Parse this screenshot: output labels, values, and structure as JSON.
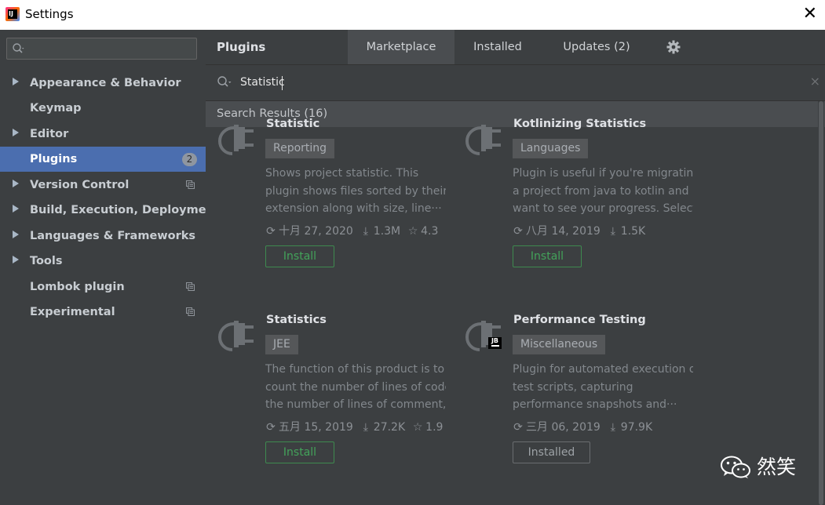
{
  "window": {
    "title": "Settings",
    "close_glyph": "✕"
  },
  "sidebar": {
    "search": {
      "value": "",
      "placeholder": ""
    },
    "items": [
      {
        "label": "Appearance & Behavior",
        "expandable": true
      },
      {
        "label": "Keymap",
        "expandable": false
      },
      {
        "label": "Editor",
        "expandable": true
      },
      {
        "label": "Plugins",
        "expandable": false,
        "selected": true,
        "badge": "2"
      },
      {
        "label": "Version Control",
        "expandable": true,
        "project_icon": true
      },
      {
        "label": "Build, Execution, Deployment",
        "expandable": true
      },
      {
        "label": "Languages & Frameworks",
        "expandable": true
      },
      {
        "label": "Tools",
        "expandable": true
      },
      {
        "label": "Lombok plugin",
        "expandable": false,
        "project_icon": true
      },
      {
        "label": "Experimental",
        "expandable": false,
        "project_icon": true
      }
    ]
  },
  "main": {
    "title": "Plugins",
    "tabs": [
      {
        "label": "Marketplace",
        "active": true
      },
      {
        "label": "Installed",
        "active": false
      },
      {
        "label": "Updates (2)",
        "active": false
      }
    ],
    "settings_icon": "gear-icon",
    "search": {
      "value": "Statistic",
      "clear_glyph": "×"
    },
    "results_header": "Search Results (16)",
    "plugins": [
      {
        "name": "Statistic",
        "tag": "Reporting",
        "description": [
          "Shows project statistic. This",
          "plugin shows files sorted by their",
          "extension along with size, line···"
        ],
        "date": "十月 27, 2020",
        "downloads": "1.3M",
        "rating": "4.3",
        "button": "Install",
        "button_state": "install",
        "jetbrains": false
      },
      {
        "name": "Kotlinizing Statistics",
        "tag": "Languages",
        "description": [
          "Plugin is useful if you're migrating",
          "a project from java to kotlin and",
          "want to see your progress. Select···"
        ],
        "date": "八月 14, 2019",
        "downloads": "1.5K",
        "rating": "",
        "button": "Install",
        "button_state": "install",
        "jetbrains": false
      },
      {
        "name": "Statistics",
        "tag": "JEE",
        "description": [
          "The function of this product is to",
          "count the number of lines of code,",
          "the number of lines of comment,···"
        ],
        "date": "五月 15, 2019",
        "downloads": "27.2K",
        "rating": "1.9",
        "button": "Install",
        "button_state": "install",
        "jetbrains": false
      },
      {
        "name": "Performance Testing",
        "tag": "Miscellaneous",
        "description": [
          "Plugin for automated execution of",
          "test scripts, capturing",
          "performance snapshots and···"
        ],
        "date": "三月 06, 2019",
        "downloads": "97.9K",
        "rating": "",
        "button": "Installed",
        "button_state": "installed",
        "jetbrains": true,
        "jetbrains_label": "JB"
      }
    ]
  },
  "watermark": {
    "text": "然笑",
    "icon": "wechat-icon"
  },
  "colors": {
    "accent": "#4b6eaf",
    "install": "#43a35a",
    "background": "#3c3f41"
  }
}
